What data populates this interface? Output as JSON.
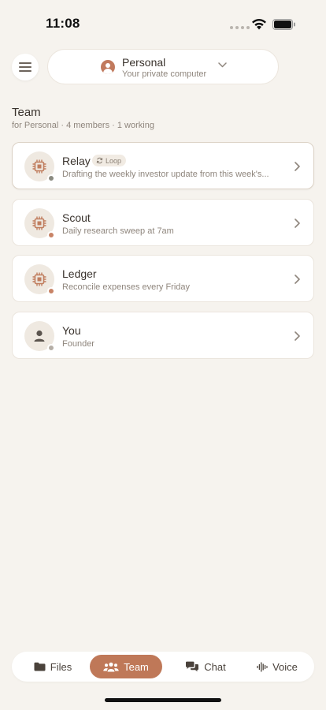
{
  "status_bar": {
    "time": "11:08"
  },
  "header": {
    "workspace_title": "Personal",
    "workspace_subtitle": "Your private computer"
  },
  "section": {
    "title": "Team",
    "subtitle": "for Personal · 4 members · 1 working"
  },
  "members": [
    {
      "name": "Relay",
      "badge": "Loop",
      "description": "Drafting the weekly investor update from this week's...",
      "icon": "chip-icon",
      "status_color": "#8a8a80"
    },
    {
      "name": "Scout",
      "description": "Daily research sweep at 7am",
      "icon": "chip-icon",
      "status_color": "#c88366"
    },
    {
      "name": "Ledger",
      "description": "Reconcile expenses every Friday",
      "icon": "chip-icon",
      "status_color": "#c88366"
    },
    {
      "name": "You",
      "description": "Founder",
      "icon": "person-icon",
      "status_color": "#b5aea6"
    }
  ],
  "tabs": [
    {
      "label": "Files",
      "icon": "folder-icon"
    },
    {
      "label": "Team",
      "icon": "people-icon",
      "active": true
    },
    {
      "label": "Chat",
      "icon": "chat-bubbles-icon"
    },
    {
      "label": "Voice",
      "icon": "waveform-icon"
    }
  ],
  "colors": {
    "accent": "#bf7858",
    "background": "#f6f3ee",
    "chip_icon": "#c07d5e"
  }
}
